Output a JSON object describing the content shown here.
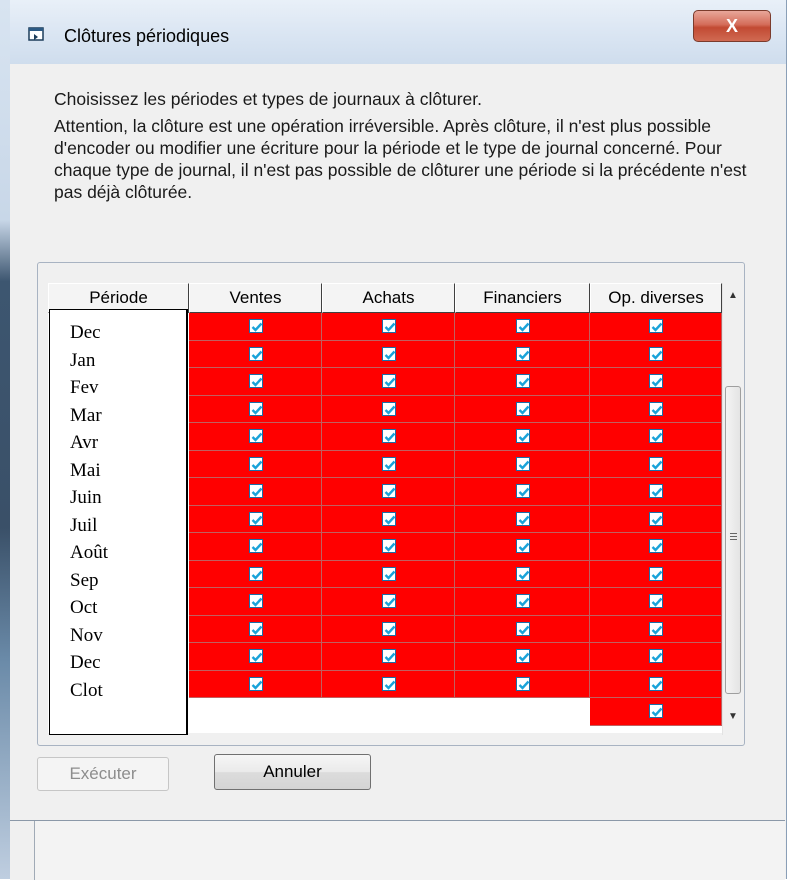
{
  "window": {
    "title": "Clôtures périodiques",
    "close_glyph": "X"
  },
  "instructions": {
    "line1": "Choisissez les périodes et types de journaux à clôturer.",
    "line2": "Attention, la clôture est une opération irréversible. Après clôture, il n'est plus possible d'encoder ou modifier une écriture pour la période et le type de journal concerné. Pour chaque type de journal, il n'est pas possible de clôturer une période si la précédente n'est pas déjà clôturée."
  },
  "grid": {
    "headers": [
      "Période",
      "Ventes",
      "Achats",
      "Financiers",
      "Op. diverses"
    ],
    "periods": [
      "Dec",
      "Jan",
      "Fev",
      "Mar",
      "Avr",
      "Mai",
      "Juin",
      "Juil",
      "Août",
      "Sep",
      "Oct",
      "Nov",
      "Dec",
      "Clot"
    ],
    "checked_color": "#ff0000",
    "checkbox_rows_per_column": {
      "ventes": 14,
      "achats": 14,
      "financiers": 14,
      "op_diverses": 15
    }
  },
  "buttons": {
    "execute": "Exécuter",
    "cancel": "Annuler"
  },
  "colors": {
    "cell_checked": "#ff0000",
    "check_mark": "#1aa3d9"
  }
}
